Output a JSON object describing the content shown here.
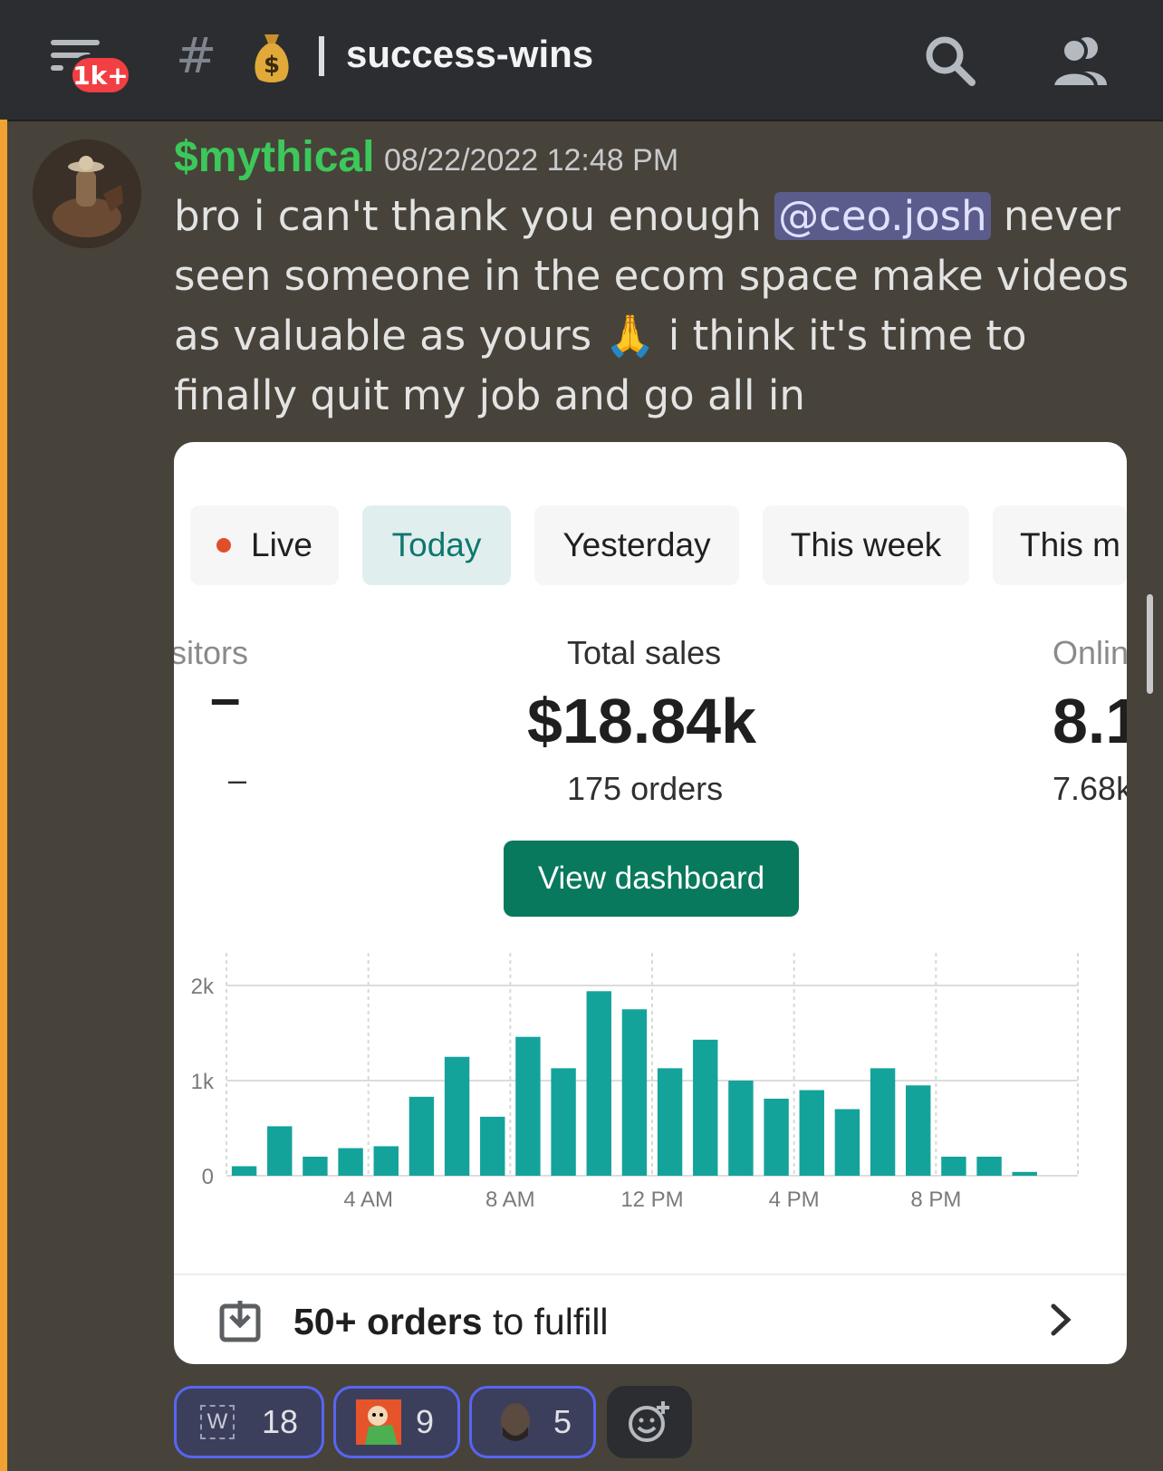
{
  "header": {
    "unread_badge": "1k+",
    "channel_emoji": "money-bag",
    "channel_name": "success-wins"
  },
  "message": {
    "username": "$mythical",
    "timestamp": "08/22/2022 12:48 PM",
    "text_before": "bro i can't thank you enough ",
    "mention": "@ceo.josh",
    "text_middle": " never seen someone in the ecom space make videos as valuable as yours ",
    "emoji": "🙏",
    "text_after": " i think it's time to finally quit my job and go all in",
    "username_color": "#3cc85a"
  },
  "card": {
    "tabs": [
      {
        "label": "Live"
      },
      {
        "label": "Today"
      },
      {
        "label": "Yesterday"
      },
      {
        "label": "This week"
      },
      {
        "label": "This m"
      }
    ],
    "metrics": {
      "left_label": "sitors",
      "left_value": "–",
      "left_sub": "–",
      "center_label": "Total sales",
      "center_value": "$18.84k",
      "center_sub": "175 orders",
      "right_label": "Onlin",
      "right_value": "8.1",
      "right_sub": "7.68k"
    },
    "button_label": "View dashboard",
    "footer_bold": "50+ orders",
    "footer_rest": " to fulfill",
    "accent_color": "#08795c",
    "bar_color": "#14a39a"
  },
  "chart_data": {
    "type": "bar",
    "categories": [
      "12 AM",
      "1 AM",
      "2 AM",
      "3 AM",
      "4 AM",
      "5 AM",
      "6 AM",
      "7 AM",
      "8 AM",
      "9 AM",
      "10 AM",
      "11 AM",
      "12 PM",
      "1 PM",
      "2 PM",
      "3 PM",
      "4 PM",
      "5 PM",
      "6 PM",
      "7 PM",
      "8 PM",
      "9 PM",
      "10 PM",
      "11 PM"
    ],
    "values": [
      100,
      520,
      200,
      290,
      310,
      830,
      1250,
      620,
      1460,
      1130,
      1940,
      1750,
      1130,
      1430,
      1000,
      810,
      900,
      700,
      1130,
      950,
      200,
      200,
      40,
      0
    ],
    "x_tick_labels": [
      "4 AM",
      "8 AM",
      "12 PM",
      "4 PM",
      "8 PM"
    ],
    "y_tick_labels": [
      "0",
      "1k",
      "2k"
    ],
    "ylim": [
      0,
      2000
    ],
    "grid": true
  },
  "reactions": [
    {
      "icon": "w-emoji",
      "count": "18"
    },
    {
      "icon": "cartoon-face-emoji",
      "count": "9"
    },
    {
      "icon": "man-face-emoji",
      "count": "5"
    }
  ]
}
